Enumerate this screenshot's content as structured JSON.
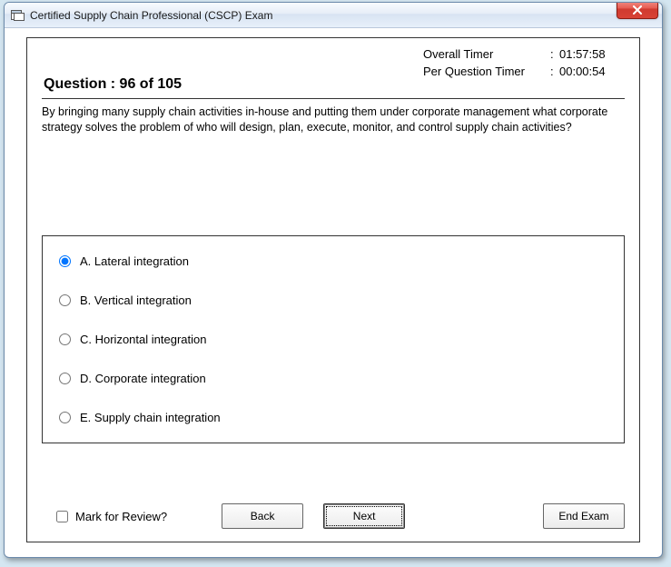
{
  "window": {
    "title": "Certified Supply Chain Professional (CSCP) Exam"
  },
  "timers": {
    "overall_label": "Overall Timer",
    "overall_value": "01:57:58",
    "per_q_label": "Per Question Timer",
    "per_q_value": "00:00:54"
  },
  "question": {
    "header": "Question : 96 of 105",
    "text": "By bringing many supply chain activities in-house and putting them under corporate management what corporate strategy solves the problem of who will design, plan, execute, monitor, and control supply chain activities?"
  },
  "answers": {
    "selected": "A",
    "options": [
      {
        "key": "A",
        "label": "A. Lateral integration"
      },
      {
        "key": "B",
        "label": "B. Vertical integration"
      },
      {
        "key": "C",
        "label": "C. Horizontal integration"
      },
      {
        "key": "D",
        "label": "D. Corporate integration"
      },
      {
        "key": "E",
        "label": "E. Supply chain integration"
      }
    ]
  },
  "controls": {
    "mark_review_label": "Mark for Review?",
    "back_label": "Back",
    "next_label": "Next",
    "end_label": "End Exam"
  }
}
